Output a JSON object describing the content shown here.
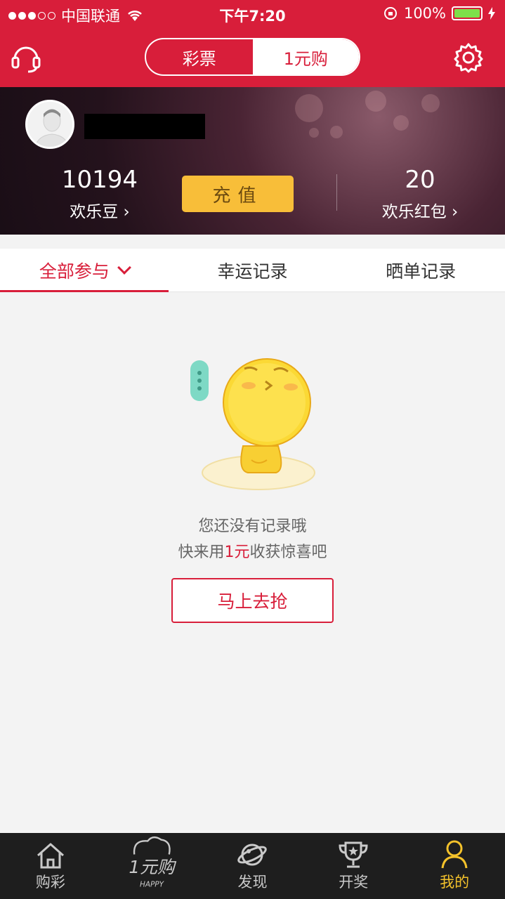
{
  "status_bar": {
    "carrier": "中国联通",
    "time": "下午7:20",
    "battery": "100%",
    "signal_dots": 5,
    "signal_filled": 3
  },
  "header": {
    "segments": [
      "彩票",
      "1元购"
    ],
    "active_segment": "1元购",
    "left_icon": "headset-icon",
    "right_icon": "gear-icon"
  },
  "profile": {
    "beans_value": "10194",
    "beans_label": "欢乐豆",
    "recharge_label": "充值",
    "redpack_value": "20",
    "redpack_label": "欢乐红包"
  },
  "tabs": [
    "全部参与",
    "幸运记录",
    "晒单记录"
  ],
  "active_tab": "全部参与",
  "empty_state": {
    "line1": "您还没有记录哦",
    "line2_prefix": "快来用",
    "line2_highlight": "1元",
    "line2_suffix": "收获惊喜吧",
    "button": "马上去抢"
  },
  "bottom_nav": [
    {
      "label": "购彩",
      "icon": "house-icon"
    },
    {
      "label": "",
      "icon": "one-yuan-happy-logo",
      "logo_text": "1元购",
      "logo_sub": "HAPPY"
    },
    {
      "label": "发现",
      "icon": "planet-icon"
    },
    {
      "label": "开奖",
      "icon": "trophy-icon"
    },
    {
      "label": "我的",
      "icon": "person-icon"
    }
  ],
  "colors": {
    "brand_red": "#d81e3a",
    "recharge_yellow": "#f8be39",
    "active_tab_yellow": "#f4c22b",
    "tabbar_bg": "#1e1e1e"
  }
}
